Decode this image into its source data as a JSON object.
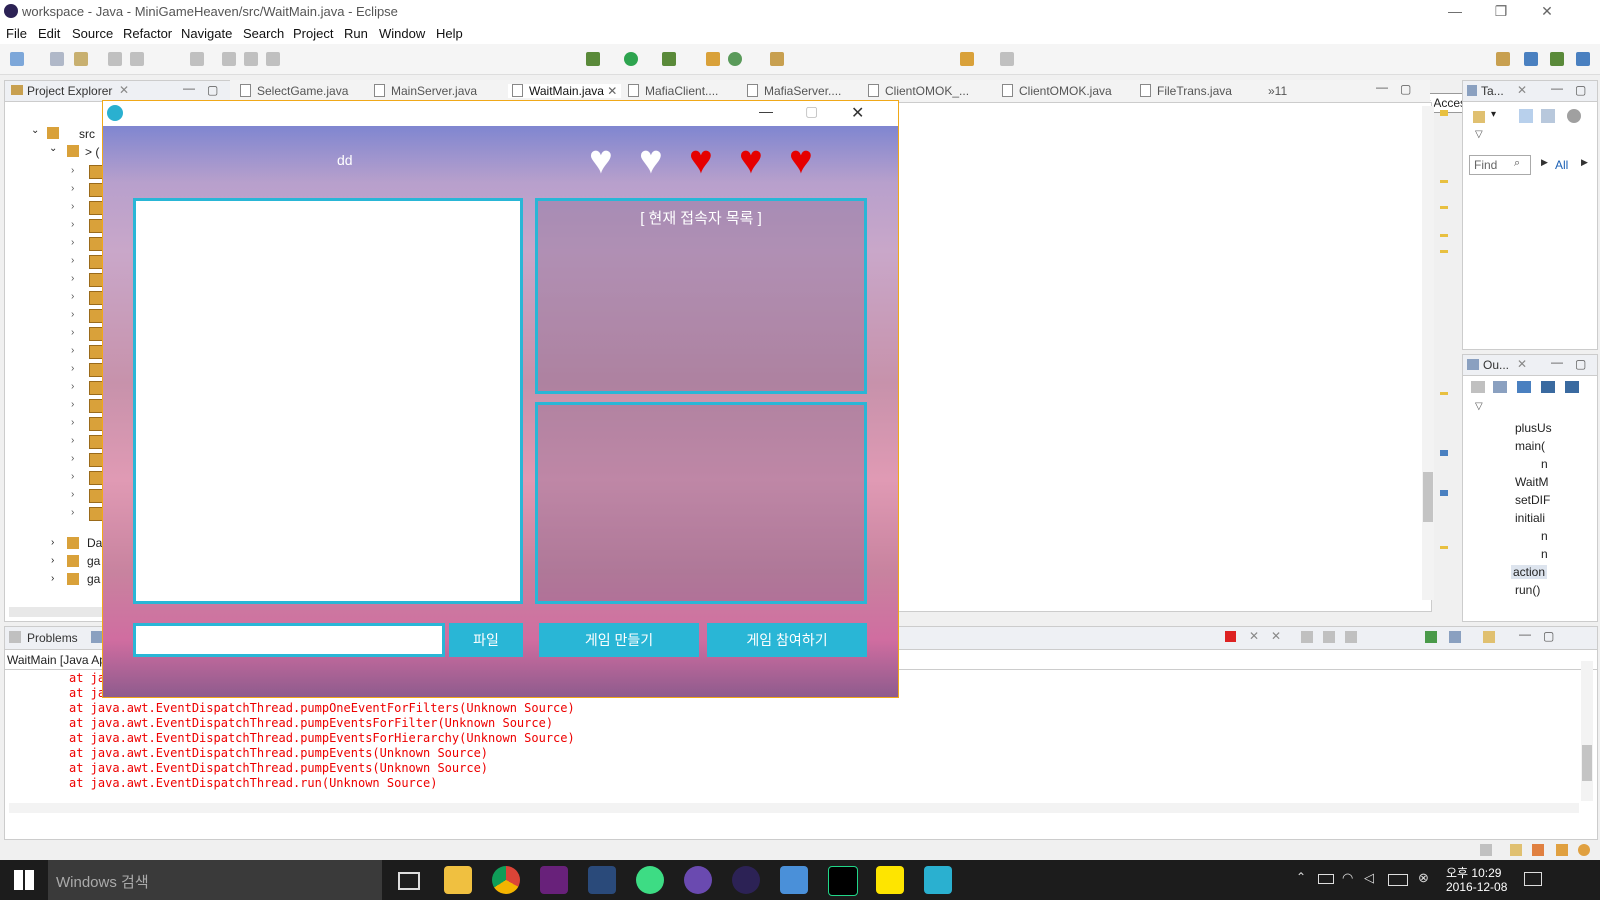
{
  "window": {
    "title": "workspace - Java - MiniGameHeaven/src/WaitMain.java - Eclipse"
  },
  "menu": [
    "File",
    "Edit",
    "Source",
    "Refactor",
    "Navigate",
    "Search",
    "Project",
    "Run",
    "Window",
    "Help"
  ],
  "toolbar": {
    "quick_access": "Quick Access"
  },
  "project_explorer": {
    "title": "Project Explorer",
    "root": "src",
    "sub": "> (",
    "bottom_items": [
      "Da",
      "ga",
      "ga"
    ]
  },
  "editor_tabs": [
    "SelectGame.java",
    "MainServer.java",
    "WaitMain.java",
    "MafiaClient....",
    "MafiaServer....",
    "ClientOMOK_...",
    "ClientOMOK.java",
    "FileTrans.java"
  ],
  "editor_tabs_overflow": "»11",
  "tasks": {
    "title": "Ta...",
    "find_placeholder": "Find",
    "all_label": "All"
  },
  "outline": {
    "title": "Ou...",
    "items": [
      "plusUs",
      "main(",
      "n",
      "WaitM",
      "setDIF",
      "initiali",
      "n",
      "n",
      "action",
      "run()"
    ]
  },
  "bottom_panel": {
    "tab": "Problems",
    "console_title": "WaitMain [Java Ap"
  },
  "console_lines": [
    "at jav",
    "at jav",
    "at java.awt.EventDispatchThread.pumpOneEventForFilters(Unknown Source)",
    "at java.awt.EventDispatchThread.pumpEventsForFilter(Unknown Source)",
    "at java.awt.EventDispatchThread.pumpEventsForHierarchy(Unknown Source)",
    "at java.awt.EventDispatchThread.pumpEvents(Unknown Source)",
    "at java.awt.EventDispatchThread.pumpEvents(Unknown Source)",
    "at java.awt.EventDispatchThread.run(Unknown Source)"
  ],
  "game_window": {
    "username": "dd",
    "lives": {
      "total": 5,
      "remaining": 3
    },
    "user_list_title": "[ 현재 접속자 목록 ]",
    "chat_input_value": "",
    "buttons": {
      "file": "파일",
      "create_game": "게임 만들기",
      "join_game": "게임 참여하기"
    },
    "accent": "#29b6d6"
  },
  "taskbar": {
    "search": "Windows 검색",
    "time": "오후 10:29",
    "date": "2016-12-08",
    "apps": [
      "task-view",
      "file-explorer",
      "chrome",
      "visual-studio",
      "app-blue",
      "android-studio",
      "app-purple",
      "eclipse",
      "notepad",
      "pycharm",
      "kakaotalk",
      "game-app"
    ]
  }
}
